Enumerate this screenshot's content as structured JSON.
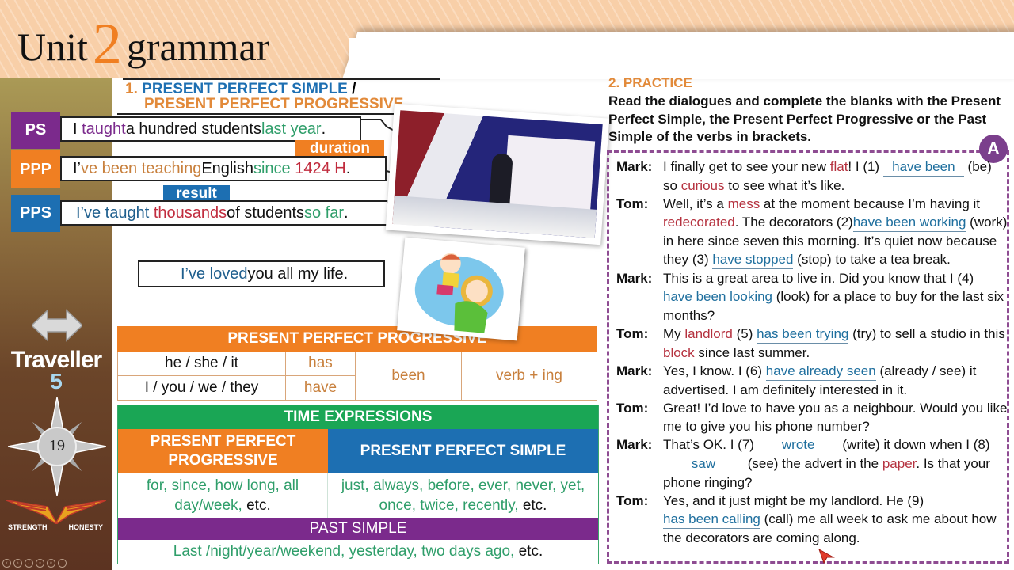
{
  "header": {
    "prefix": "Unit",
    "number": "2",
    "suffix": "grammar"
  },
  "sidebar": {
    "nav_icon": "double-arrow-icon",
    "brand": "Traveller",
    "brand_level": "5",
    "page_number": "19",
    "logo_left": "STRENGTH",
    "logo_right": "HONESTY",
    "slide_controls": [
      "previous",
      "next",
      "pen",
      "slides",
      "zoom",
      "more"
    ]
  },
  "section1": {
    "number": "1.",
    "title_a": "PRESENT PERFECT SIMPLE",
    "separator": "/",
    "title_b": "PRESENT PERFECT PROGRESSIVE",
    "examples": [
      {
        "tag": "PS",
        "tag_color": "#7b2a8c",
        "parts": [
          "I ",
          "taught",
          " a hundred students ",
          "last year",
          "."
        ]
      },
      {
        "tag": "PPP",
        "tag_color": "#f07f22",
        "parts": [
          "I’",
          "ve been teaching",
          " English ",
          "since",
          " ",
          "1424 H",
          "."
        ]
      },
      {
        "tag": "PPS",
        "tag_color": "#1d6fb2",
        "parts": [
          "I’ve taught",
          " ",
          "thousands",
          " of students ",
          "so far",
          "."
        ]
      }
    ],
    "chip_duration": "duration",
    "chip_result": "result",
    "extra_sentence": {
      "highlight": "I’ve loved",
      "rest": " you all my life."
    }
  },
  "ppp_table": {
    "title": "PRESENT PERFECT PROGRESSIVE",
    "rows": [
      {
        "pronoun": "he / she / it",
        "aux": "has"
      },
      {
        "pronoun": "I / you / we / they",
        "aux": "have"
      }
    ],
    "been": "been",
    "form": "verb + ing"
  },
  "time_expressions": {
    "title": "TIME EXPRESSIONS",
    "ppp_head": "PRESENT PERFECT PROGRESSIVE",
    "pps_head": "PRESENT PERFECT SIMPLE",
    "ppp_words": "for, since, how long, all day/week,",
    "pps_words": "just, always, before, ever, never, yet, once, twice, recently,",
    "etc": "etc.",
    "past_head": "PAST SIMPLE",
    "past_words": "Last /night/year/weekend, yesterday, two days ago,"
  },
  "practice": {
    "title": "2. PRACTICE",
    "instructions": "Read the dialogues and complete the blanks with the Present Perfect Simple, the Present Perfect Progressive or the Past Simple of the verbs in brackets.",
    "badge": "A",
    "answers": [
      "have been",
      "have been working",
      "have stopped",
      "have been looking",
      "has been trying",
      "have already seen",
      "wrote",
      "saw",
      "has been calling"
    ],
    "speakers": {
      "mark": "Mark:",
      "tom": "Tom:"
    }
  },
  "colors": {
    "orange": "#f07f22",
    "blue": "#1d6fb2",
    "purple": "#7b2a8c",
    "green": "#1aa655",
    "answer": "#1f6f9e",
    "highlight": "#b5323f"
  }
}
